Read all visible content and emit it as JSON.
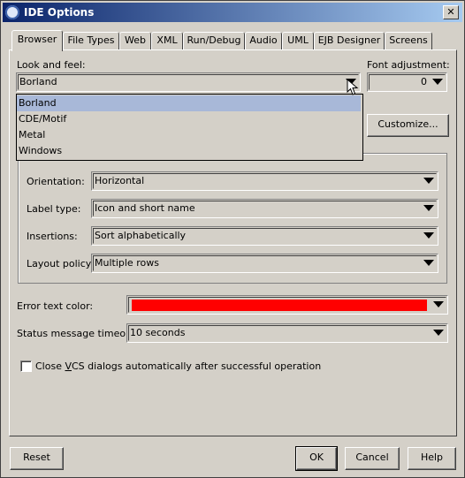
{
  "window": {
    "title": "IDE Options",
    "close_symbol": "✕"
  },
  "tabs": [
    "Browser",
    "File Types",
    "Web",
    "XML",
    "Run/Debug",
    "Audio",
    "UML",
    "EJB Designer",
    "Screens"
  ],
  "active_tab": "Browser",
  "look_and_feel": {
    "label": "Look and feel:",
    "value": "Borland",
    "options": [
      "Borland",
      "CDE/Motif",
      "Metal",
      "Windows"
    ],
    "highlighted": "Borland"
  },
  "font_adjustment": {
    "label": "Font adjustment:",
    "value": "0"
  },
  "customize_button": "Customize...",
  "content_tabs": {
    "orientation": {
      "label": "Orientation:",
      "value": "Horizontal"
    },
    "label_type": {
      "label": "Label type:",
      "value": "Icon and short name"
    },
    "insertions": {
      "label": "Insertions:",
      "value": "Sort alphabetically"
    },
    "layout_policy": {
      "label": "Layout policy:",
      "value": "Multiple rows"
    }
  },
  "error_text_color": {
    "label": "Error text color:",
    "color": "#ff0000"
  },
  "status_timeout": {
    "label": "Status message timeout:",
    "value": "10 seconds"
  },
  "close_vcs": {
    "label_pre": "Close ",
    "label_u": "V",
    "label_post": "CS dialogs automatically after successful operation",
    "checked": false
  },
  "buttons": {
    "reset": "Reset",
    "ok": "OK",
    "cancel": "Cancel",
    "help": "Help"
  }
}
